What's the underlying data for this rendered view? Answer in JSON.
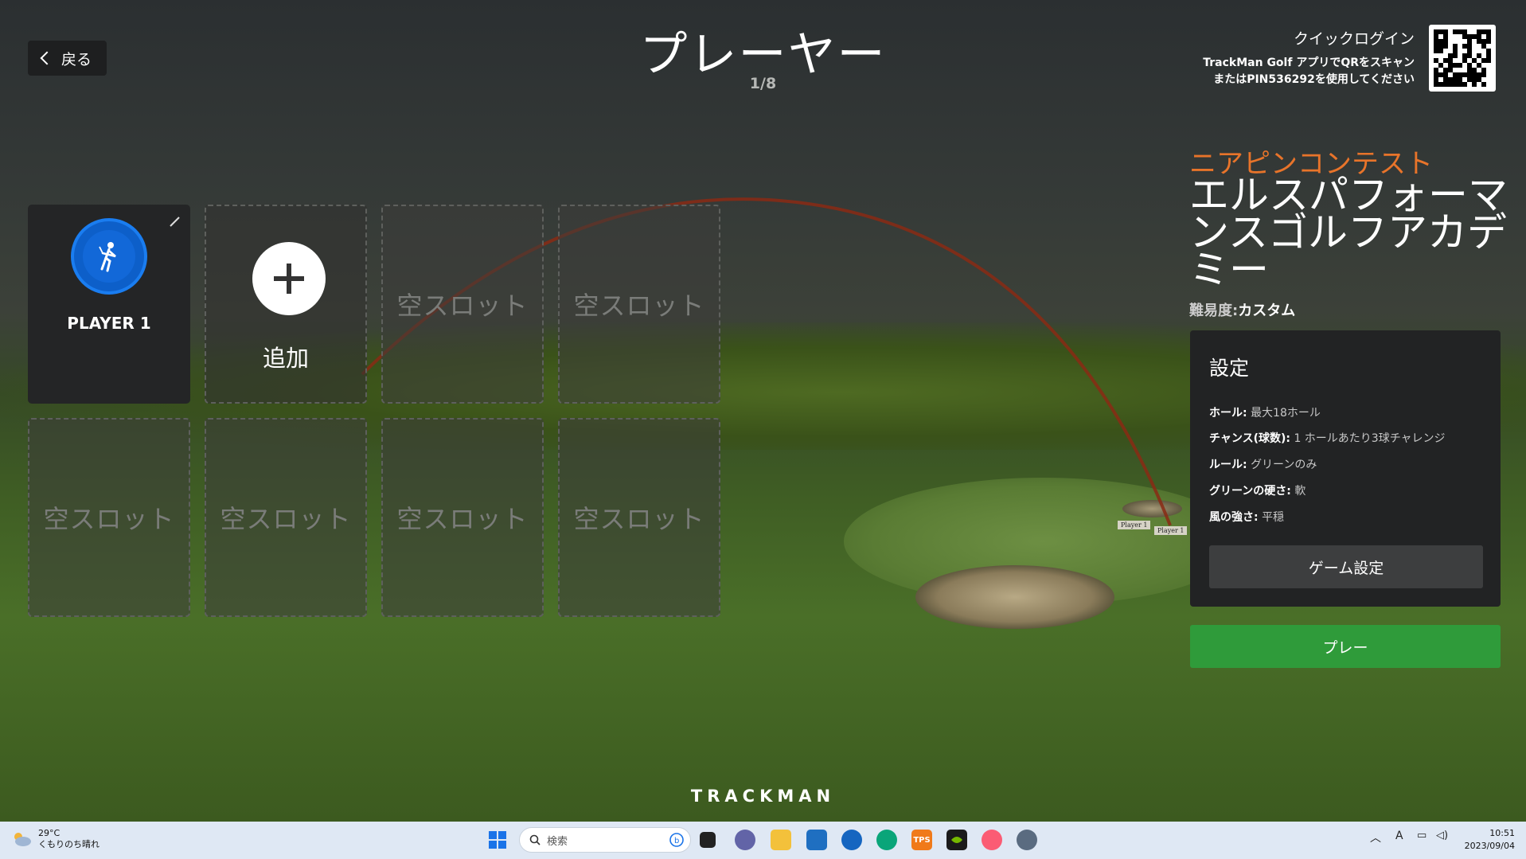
{
  "header": {
    "back_label": "戻る",
    "title": "プレーヤー",
    "count": "1/8",
    "quick_login_title": "クイックログイン",
    "quick_login_line1": "TrackMan Golf アプリでQRをスキャン",
    "quick_login_line2": "またはPIN536292を使用してください"
  },
  "players": {
    "player1_name": "PLAYER 1",
    "add_label": "追加",
    "empty_label": "空スロット"
  },
  "contest": {
    "type": "ニアピンコンテスト",
    "name": "エルスパフォーマンスゴルフアカデミー",
    "difficulty_label": "難易度:",
    "difficulty_value": "カスタム"
  },
  "settings": {
    "title": "設定",
    "rows": [
      {
        "key": "ホール:",
        "value": "最大18ホール"
      },
      {
        "key": "チャンス(球数):",
        "value": "1 ホールあたり3球チャレンジ"
      },
      {
        "key": "ルール:",
        "value": "グリーンのみ"
      },
      {
        "key": "グリーンの硬さ:",
        "value": "軟"
      },
      {
        "key": "風の強さ:",
        "value": "平穏"
      }
    ],
    "game_settings_label": "ゲーム設定",
    "play_label": "プレー"
  },
  "scene": {
    "flag_label_1": "Player 1",
    "flag_label_2": "Player 1"
  },
  "brand": "TRACKMAN",
  "taskbar": {
    "temperature": "29°C",
    "weather": "くもりのち晴れ",
    "search_placeholder": "検索",
    "tps_label": "TPS",
    "ime": "A",
    "time": "10:51",
    "date": "2023/09/04"
  },
  "colors": {
    "accent_orange": "#e8742a",
    "play_green": "#2f9b3a",
    "avatar_blue": "#1a7df0"
  }
}
